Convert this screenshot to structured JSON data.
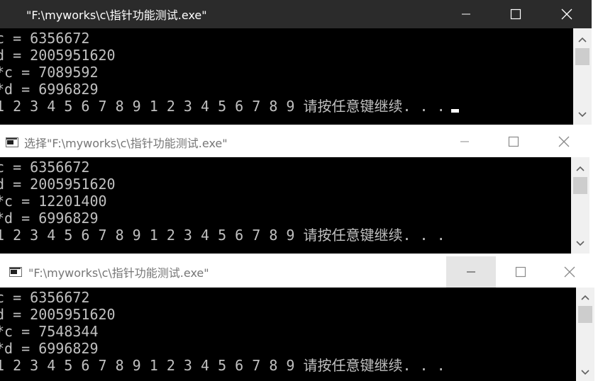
{
  "windows": [
    {
      "title": "\"F:\\myworks\\c\\指针功能测试.exe\"",
      "active": true,
      "lines": [
        "c = 6356672",
        "d = 2005951620",
        "*c = 7089592",
        "*d = 6996829",
        "1 2 3 4 5 6 7 8 9 1 2 3 4 5 6 7 8 9 请按任意键继续. . ."
      ],
      "has_cursor": true
    },
    {
      "title": "选择\"F:\\myworks\\c\\指针功能测试.exe\"",
      "active": false,
      "lines": [
        "c = 6356672",
        "d = 2005951620",
        "*c = 12201400",
        "*d = 6996829",
        "1 2 3 4 5 6 7 8 9 1 2 3 4 5 6 7 8 9 请按任意键继续. . ."
      ],
      "has_cursor": false
    },
    {
      "title": "\"F:\\myworks\\c\\指针功能测试.exe\"",
      "active": false,
      "lines": [
        "c = 6356672",
        "d = 2005951620",
        "*c = 7548344",
        "*d = 6996829",
        "1 2 3 4 5 6 7 8 9 1 2 3 4 5 6 7 8 9 请按任意键继续. . ."
      ],
      "has_cursor": false
    }
  ],
  "icons": {
    "minimize": "minimize-icon",
    "maximize": "maximize-icon",
    "close": "close-icon",
    "scroll_up": "chevron-up-icon",
    "scroll_down": "chevron-down-icon",
    "app": "console-app-icon"
  },
  "colors": {
    "active_titlebar": "#2b2b2b",
    "active_title_text": "#ffffff",
    "inactive_titlebar": "#ffffff",
    "inactive_title_text": "#767676",
    "console_background": "#000000",
    "console_text": "#c0c0c0",
    "hovered_minimize": "#e5e5e5"
  }
}
